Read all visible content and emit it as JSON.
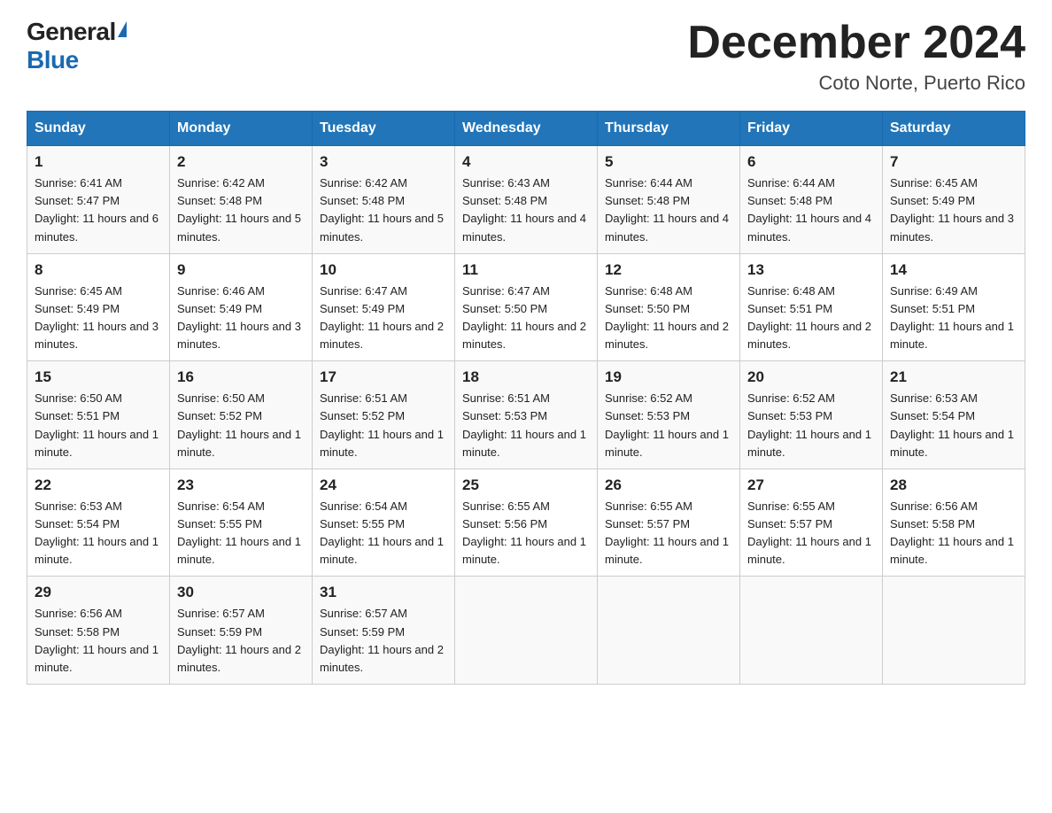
{
  "header": {
    "logo_general": "General",
    "logo_blue": "Blue",
    "month_title": "December 2024",
    "location": "Coto Norte, Puerto Rico"
  },
  "columns": [
    "Sunday",
    "Monday",
    "Tuesday",
    "Wednesday",
    "Thursday",
    "Friday",
    "Saturday"
  ],
  "weeks": [
    [
      {
        "day": "1",
        "sunrise": "6:41 AM",
        "sunset": "5:47 PM",
        "daylight": "11 hours and 6 minutes."
      },
      {
        "day": "2",
        "sunrise": "6:42 AM",
        "sunset": "5:48 PM",
        "daylight": "11 hours and 5 minutes."
      },
      {
        "day": "3",
        "sunrise": "6:42 AM",
        "sunset": "5:48 PM",
        "daylight": "11 hours and 5 minutes."
      },
      {
        "day": "4",
        "sunrise": "6:43 AM",
        "sunset": "5:48 PM",
        "daylight": "11 hours and 4 minutes."
      },
      {
        "day": "5",
        "sunrise": "6:44 AM",
        "sunset": "5:48 PM",
        "daylight": "11 hours and 4 minutes."
      },
      {
        "day": "6",
        "sunrise": "6:44 AM",
        "sunset": "5:48 PM",
        "daylight": "11 hours and 4 minutes."
      },
      {
        "day": "7",
        "sunrise": "6:45 AM",
        "sunset": "5:49 PM",
        "daylight": "11 hours and 3 minutes."
      }
    ],
    [
      {
        "day": "8",
        "sunrise": "6:45 AM",
        "sunset": "5:49 PM",
        "daylight": "11 hours and 3 minutes."
      },
      {
        "day": "9",
        "sunrise": "6:46 AM",
        "sunset": "5:49 PM",
        "daylight": "11 hours and 3 minutes."
      },
      {
        "day": "10",
        "sunrise": "6:47 AM",
        "sunset": "5:49 PM",
        "daylight": "11 hours and 2 minutes."
      },
      {
        "day": "11",
        "sunrise": "6:47 AM",
        "sunset": "5:50 PM",
        "daylight": "11 hours and 2 minutes."
      },
      {
        "day": "12",
        "sunrise": "6:48 AM",
        "sunset": "5:50 PM",
        "daylight": "11 hours and 2 minutes."
      },
      {
        "day": "13",
        "sunrise": "6:48 AM",
        "sunset": "5:51 PM",
        "daylight": "11 hours and 2 minutes."
      },
      {
        "day": "14",
        "sunrise": "6:49 AM",
        "sunset": "5:51 PM",
        "daylight": "11 hours and 1 minute."
      }
    ],
    [
      {
        "day": "15",
        "sunrise": "6:50 AM",
        "sunset": "5:51 PM",
        "daylight": "11 hours and 1 minute."
      },
      {
        "day": "16",
        "sunrise": "6:50 AM",
        "sunset": "5:52 PM",
        "daylight": "11 hours and 1 minute."
      },
      {
        "day": "17",
        "sunrise": "6:51 AM",
        "sunset": "5:52 PM",
        "daylight": "11 hours and 1 minute."
      },
      {
        "day": "18",
        "sunrise": "6:51 AM",
        "sunset": "5:53 PM",
        "daylight": "11 hours and 1 minute."
      },
      {
        "day": "19",
        "sunrise": "6:52 AM",
        "sunset": "5:53 PM",
        "daylight": "11 hours and 1 minute."
      },
      {
        "day": "20",
        "sunrise": "6:52 AM",
        "sunset": "5:53 PM",
        "daylight": "11 hours and 1 minute."
      },
      {
        "day": "21",
        "sunrise": "6:53 AM",
        "sunset": "5:54 PM",
        "daylight": "11 hours and 1 minute."
      }
    ],
    [
      {
        "day": "22",
        "sunrise": "6:53 AM",
        "sunset": "5:54 PM",
        "daylight": "11 hours and 1 minute."
      },
      {
        "day": "23",
        "sunrise": "6:54 AM",
        "sunset": "5:55 PM",
        "daylight": "11 hours and 1 minute."
      },
      {
        "day": "24",
        "sunrise": "6:54 AM",
        "sunset": "5:55 PM",
        "daylight": "11 hours and 1 minute."
      },
      {
        "day": "25",
        "sunrise": "6:55 AM",
        "sunset": "5:56 PM",
        "daylight": "11 hours and 1 minute."
      },
      {
        "day": "26",
        "sunrise": "6:55 AM",
        "sunset": "5:57 PM",
        "daylight": "11 hours and 1 minute."
      },
      {
        "day": "27",
        "sunrise": "6:55 AM",
        "sunset": "5:57 PM",
        "daylight": "11 hours and 1 minute."
      },
      {
        "day": "28",
        "sunrise": "6:56 AM",
        "sunset": "5:58 PM",
        "daylight": "11 hours and 1 minute."
      }
    ],
    [
      {
        "day": "29",
        "sunrise": "6:56 AM",
        "sunset": "5:58 PM",
        "daylight": "11 hours and 1 minute."
      },
      {
        "day": "30",
        "sunrise": "6:57 AM",
        "sunset": "5:59 PM",
        "daylight": "11 hours and 2 minutes."
      },
      {
        "day": "31",
        "sunrise": "6:57 AM",
        "sunset": "5:59 PM",
        "daylight": "11 hours and 2 minutes."
      },
      null,
      null,
      null,
      null
    ]
  ]
}
